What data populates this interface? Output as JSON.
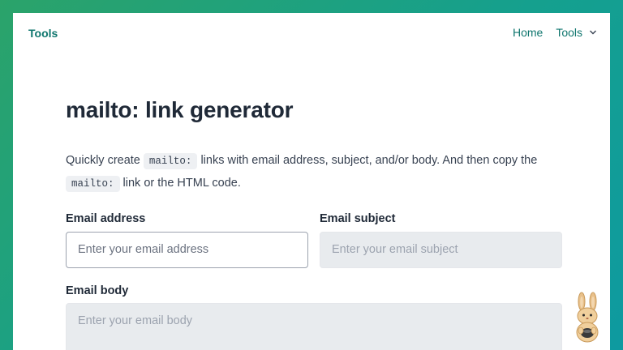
{
  "header": {
    "brand": "Tools",
    "nav": {
      "home": "Home",
      "tools": "Tools"
    }
  },
  "main": {
    "title": "mailto: link generator",
    "intro": {
      "part1": "Quickly create ",
      "code1": "mailto:",
      "part2": " links with email address, subject, and/or body. And then copy the ",
      "code2": "mailto:",
      "part3": " link or the HTML code."
    },
    "fields": {
      "address": {
        "label": "Email address",
        "placeholder": "Enter your email address"
      },
      "subject": {
        "label": "Email subject",
        "placeholder": "Enter your email subject"
      },
      "body": {
        "label": "Email body",
        "placeholder": "Enter your email body"
      }
    }
  },
  "colors": {
    "accent": "#0f766e",
    "background_start": "#2ba36a",
    "background_end": "#0e9aa0"
  },
  "icons": {
    "dropdown": "chevron-down-icon",
    "mascot": "rabbit-mascot-icon"
  }
}
